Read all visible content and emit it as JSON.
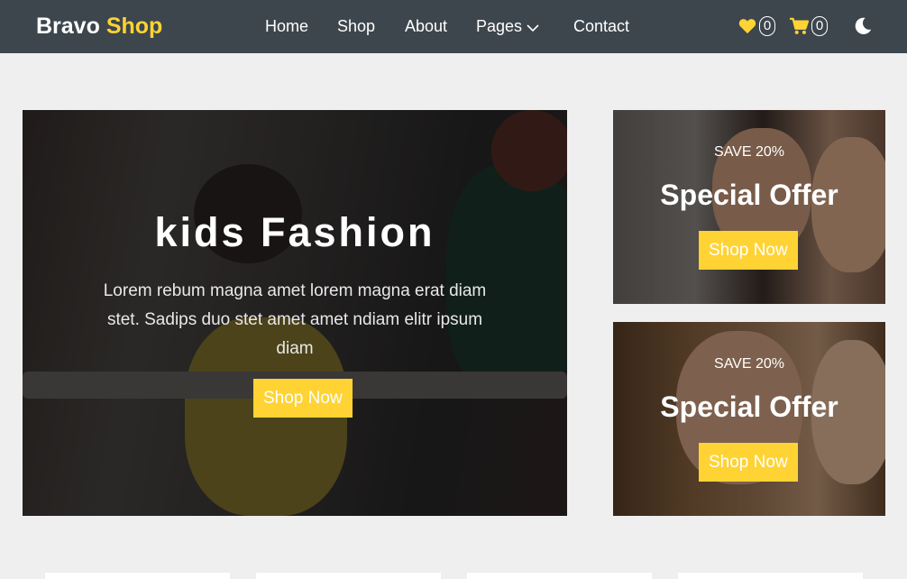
{
  "brand": {
    "name": "Bravo",
    "accent": "Shop"
  },
  "nav": {
    "links": [
      "Home",
      "Shop",
      "About"
    ],
    "pages": "Pages",
    "contact": "Contact"
  },
  "icons": {
    "wishlist_icon": "heart-icon",
    "wishlist_count": "0",
    "cart_icon": "cart-icon",
    "cart_count": "0",
    "theme_icon": "moon-icon"
  },
  "hero": {
    "title": "kids Fashion",
    "text": "Lorem rebum magna amet lorem magna erat diam stet. Sadips duo stet amet amet ndiam elitr ipsum diam",
    "button": "Shop Now"
  },
  "offers": [
    {
      "subtitle": "SAVE 20%",
      "title": "Special Offer",
      "button": "Shop Now"
    },
    {
      "subtitle": "SAVE 20%",
      "title": "Special Offer",
      "button": "Shop Now"
    }
  ],
  "colors": {
    "accent": "#ffd333",
    "navbar": "#3d464d",
    "background": "#efefef"
  }
}
